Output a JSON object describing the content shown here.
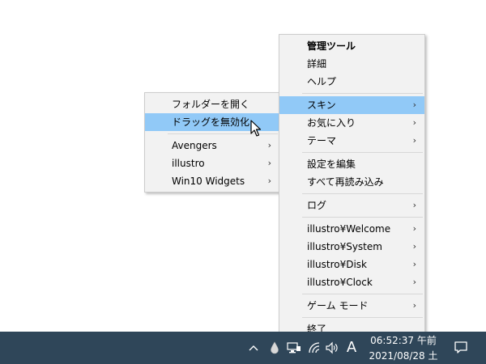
{
  "main_menu": {
    "items": [
      {
        "label": "管理ツール"
      },
      {
        "label": "詳細"
      },
      {
        "label": "ヘルプ"
      },
      {
        "label": "スキン",
        "arrow": "›"
      },
      {
        "label": "お気に入り",
        "arrow": "›"
      },
      {
        "label": "テーマ",
        "arrow": "›"
      },
      {
        "label": "設定を編集"
      },
      {
        "label": "すべて再読み込み"
      },
      {
        "label": "ログ",
        "arrow": "›"
      },
      {
        "label": "illustro¥Welcome",
        "arrow": "›"
      },
      {
        "label": "illustro¥System",
        "arrow": "›"
      },
      {
        "label": "illustro¥Disk",
        "arrow": "›"
      },
      {
        "label": "illustro¥Clock",
        "arrow": "›"
      },
      {
        "label": "ゲーム モード",
        "arrow": "›"
      },
      {
        "label": "終了"
      }
    ]
  },
  "sub_menu": {
    "items": [
      {
        "label": "フォルダーを開く"
      },
      {
        "label": "ドラッグを無効化"
      },
      {
        "label": "Avengers",
        "arrow": "›"
      },
      {
        "label": "illustro",
        "arrow": "›"
      },
      {
        "label": "Win10 Widgets",
        "arrow": "›"
      }
    ]
  },
  "taskbar": {
    "chevron": "^",
    "ime": "A",
    "time": "06:52:37 午前",
    "date": "2021/08/28 土",
    "notification_icon": "action-center-icon"
  },
  "colors": {
    "highlight": "#91c9f7",
    "menu_bg": "#f2f2f2",
    "taskbar_bg": "#2f4659"
  }
}
